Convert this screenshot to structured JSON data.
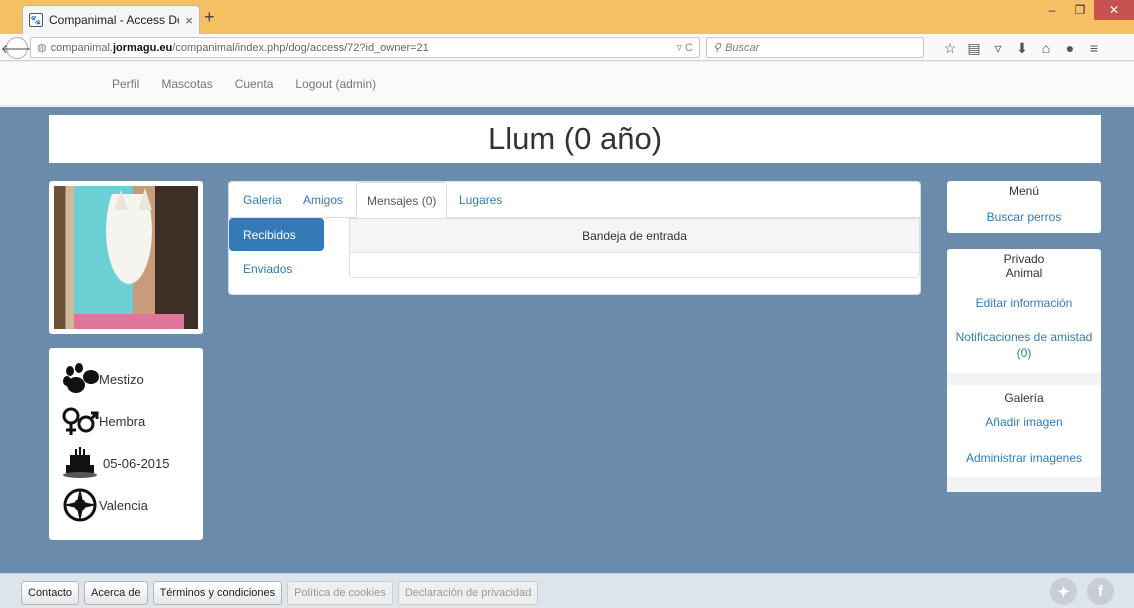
{
  "browser": {
    "tab_title": "Companimal - Access Dog",
    "tab_close": "×",
    "new_tab": "+",
    "url_host_prefix": "companimal.",
    "url_host_bold": "jormagu.eu",
    "url_path": "/companimal/index.php/dog/access/72?id_owner=21",
    "search_placeholder": "Buscar"
  },
  "site_nav": {
    "items": [
      "Perfil",
      "Mascotas",
      "Cuenta",
      "Logout (admin)"
    ]
  },
  "page_title": "Llum (0 año)",
  "info": {
    "breed": "Mestizo",
    "sex": "Hembra",
    "birthdate": "05-06-2015",
    "location": "Valencia"
  },
  "center": {
    "tabs": [
      "Galeria",
      "Amigos",
      "Mensajes (0)",
      "Lugares"
    ],
    "pills": [
      "Recibidos",
      "Enviados"
    ],
    "inbox_title": "Bandeja de entrada"
  },
  "menu": {
    "title": "Menú",
    "link": "Buscar perros"
  },
  "private": {
    "title": "Privado",
    "animal_title": "Animal",
    "edit_info": "Editar información",
    "friend_notifications": "Notificaciones de amistad",
    "friend_count": "(0)",
    "gallery_title": "Galería",
    "add_image": "Añadir imagen",
    "manage_images": "Administrar imagenes"
  },
  "footer": {
    "buttons": [
      "Contacto",
      "Acerca de",
      "Términos y condiciones",
      "Política de cookies",
      "Declaración de privacidad"
    ]
  },
  "colors": {
    "background": "#6b8cad",
    "link": "#337ab7",
    "active_pill": "#337ab7",
    "browser_tabbar": "#f5c063"
  }
}
